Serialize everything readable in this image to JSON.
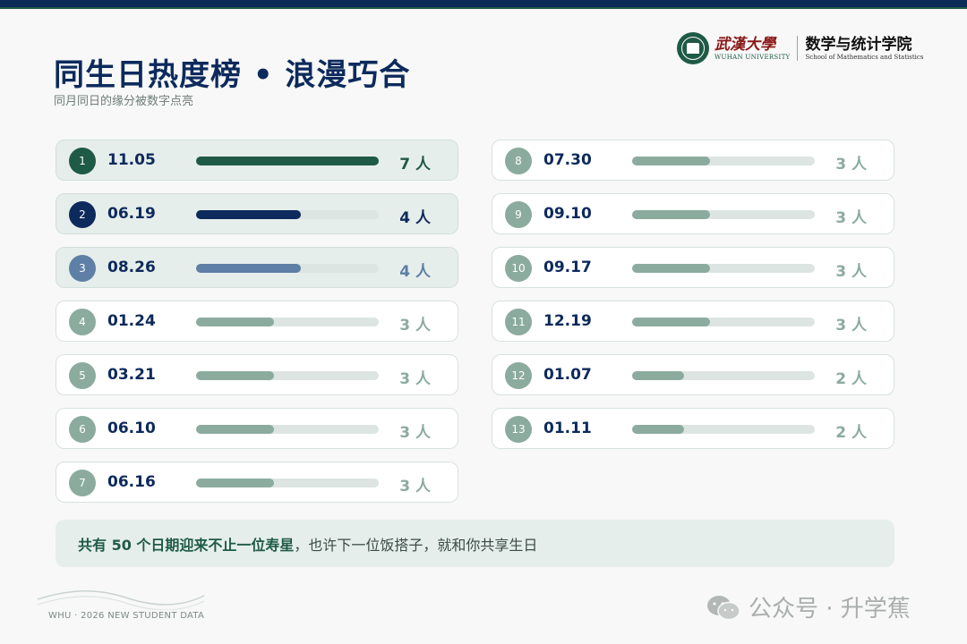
{
  "header": {
    "title": "同生日热度榜 • 浪漫巧合",
    "subtitle": "同月同日的缘分被数字点亮"
  },
  "logo": {
    "university_cn": "武漢大學",
    "university_en": "WUHAN UNIVERSITY",
    "school_cn": "数学与统计学院",
    "school_en": "School of Mathematics and Statistics"
  },
  "colors": {
    "rank1": "#1f5a46",
    "rank2": "#0d2a5c",
    "rank3": "#5e7fa6",
    "rest": "#8cab9f"
  },
  "chart_data": {
    "type": "bar",
    "unit": "人",
    "xlim": [
      0,
      7
    ],
    "categories": [
      "11.05",
      "06.19",
      "08.26",
      "01.24",
      "03.21",
      "06.10",
      "06.16",
      "07.30",
      "09.10",
      "09.17",
      "12.19",
      "01.07",
      "01.11"
    ],
    "values": [
      7,
      4,
      4,
      3,
      3,
      3,
      3,
      3,
      3,
      3,
      3,
      2,
      2
    ],
    "ranks": [
      "1",
      "2",
      "3",
      "4",
      "5",
      "6",
      "7",
      "8",
      "9",
      "10",
      "11",
      "12",
      "13"
    ],
    "labels": [
      "7 人",
      "4 人",
      "4 人",
      "3 人",
      "3 人",
      "3 人",
      "3 人",
      "3 人",
      "3 人",
      "3 人",
      "3 人",
      "2 人",
      "2 人"
    ]
  },
  "note": {
    "strong": "共有 50 个日期迎来不止一位寿星",
    "rest": "，也许下一位饭搭子，就和你共享生日"
  },
  "footer": {
    "text": "WHU · 2026 NEW STUDENT DATA",
    "watermark": "公众号 · 升学蕉"
  }
}
